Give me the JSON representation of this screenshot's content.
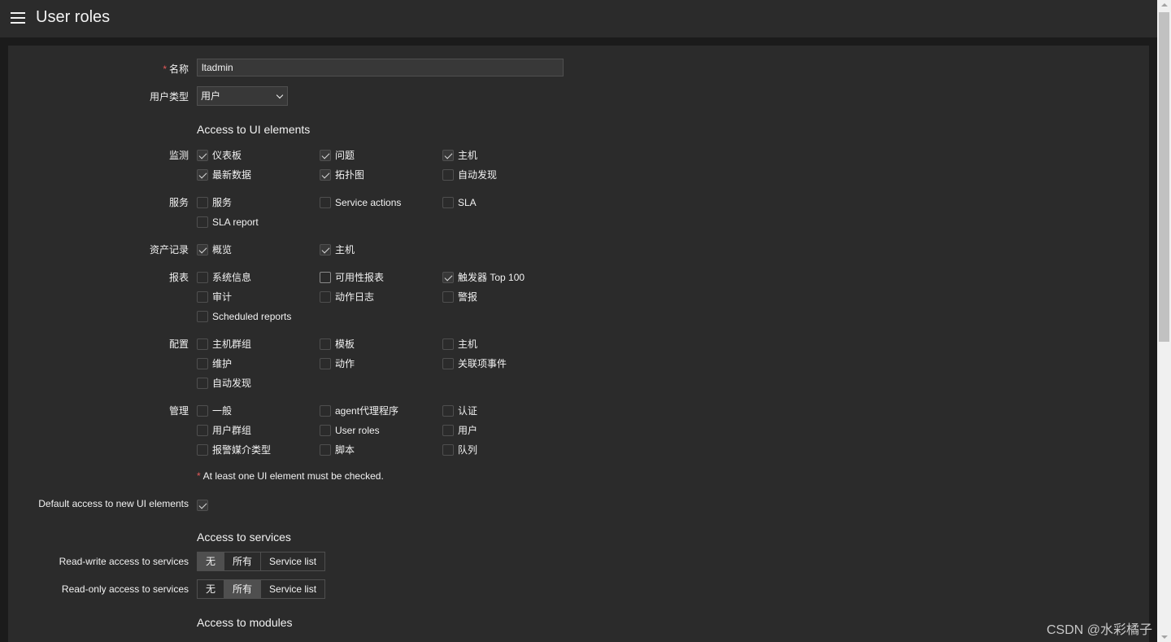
{
  "header": {
    "title": "User roles",
    "menu_icon": "hamburger-menu-icon"
  },
  "form": {
    "name_label": "名称",
    "name_required_mark": "*",
    "name_value": "ltadmin",
    "user_type_label": "用户类型",
    "user_type_value": "用户",
    "ui_section_title": "Access to UI elements",
    "groups": {
      "monitor": {
        "label": "监测",
        "items": [
          {
            "label": "仪表板",
            "checked": true
          },
          {
            "label": "问题",
            "checked": true
          },
          {
            "label": "主机",
            "checked": true
          },
          {
            "label": "最新数据",
            "checked": true
          },
          {
            "label": "拓扑图",
            "checked": true
          },
          {
            "label": "自动发现",
            "checked": false
          }
        ]
      },
      "services": {
        "label": "服务",
        "items": [
          {
            "label": "服务",
            "checked": false
          },
          {
            "label": "Service actions",
            "checked": false
          },
          {
            "label": "SLA",
            "checked": false
          },
          {
            "label": "SLA report",
            "checked": false
          }
        ]
      },
      "inventory": {
        "label": "资产记录",
        "items": [
          {
            "label": "概览",
            "checked": true
          },
          {
            "label": "主机",
            "checked": true
          }
        ]
      },
      "reports": {
        "label": "报表",
        "items": [
          {
            "label": "系统信息",
            "checked": false
          },
          {
            "label": "可用性报表",
            "checked": false
          },
          {
            "label": "触发器 Top 100",
            "checked": true
          },
          {
            "label": "审计",
            "checked": false
          },
          {
            "label": "动作日志",
            "checked": false
          },
          {
            "label": "警报",
            "checked": false
          },
          {
            "label": "Scheduled reports",
            "checked": false
          }
        ]
      },
      "config": {
        "label": "配置",
        "items": [
          {
            "label": "主机群组",
            "checked": false
          },
          {
            "label": "模板",
            "checked": false
          },
          {
            "label": "主机",
            "checked": false
          },
          {
            "label": "维护",
            "checked": false
          },
          {
            "label": "动作",
            "checked": false
          },
          {
            "label": "关联项事件",
            "checked": false
          },
          {
            "label": "自动发现",
            "checked": false
          }
        ]
      },
      "admin": {
        "label": "管理",
        "items": [
          {
            "label": "一般",
            "checked": false
          },
          {
            "label": "agent代理程序",
            "checked": false
          },
          {
            "label": "认证",
            "checked": false
          },
          {
            "label": "用户群组",
            "checked": false
          },
          {
            "label": "User roles",
            "checked": false
          },
          {
            "label": "用户",
            "checked": false
          },
          {
            "label": "报警媒介类型",
            "checked": false
          },
          {
            "label": "脚本",
            "checked": false
          },
          {
            "label": "队列",
            "checked": false
          }
        ]
      }
    },
    "hint_mark": "*",
    "hint_text": "At least one UI element must be checked.",
    "default_access_label": "Default access to new UI elements",
    "default_access_checked": true,
    "services_section_title": "Access to services",
    "rw_services_label": "Read-write access to services",
    "ro_services_label": "Read-only access to services",
    "service_options": [
      "无",
      "所有",
      "Service list"
    ],
    "rw_selected": "无",
    "ro_selected": "所有",
    "modules_section_title": "Access to modules"
  },
  "watermark": "CSDN @水彩橘子"
}
